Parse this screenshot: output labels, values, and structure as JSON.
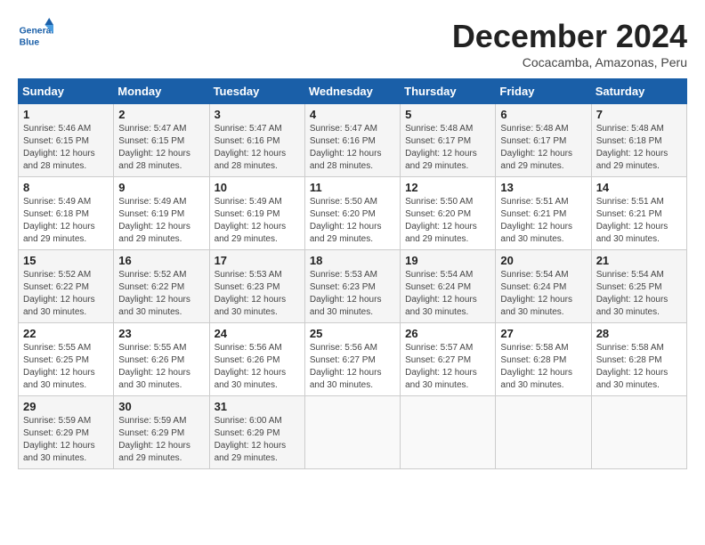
{
  "header": {
    "logo_text_general": "General",
    "logo_text_blue": "Blue",
    "month_title": "December 2024",
    "location": "Cocacamba, Amazonas, Peru"
  },
  "calendar": {
    "days_of_week": [
      "Sunday",
      "Monday",
      "Tuesday",
      "Wednesday",
      "Thursday",
      "Friday",
      "Saturday"
    ],
    "weeks": [
      [
        {
          "day": "",
          "info": ""
        },
        {
          "day": "",
          "info": ""
        },
        {
          "day": "",
          "info": ""
        },
        {
          "day": "",
          "info": ""
        },
        {
          "day": "",
          "info": ""
        },
        {
          "day": "",
          "info": ""
        },
        {
          "day": "",
          "info": ""
        }
      ]
    ],
    "cells": [
      {
        "day": "1",
        "sunrise": "5:46 AM",
        "sunset": "6:15 PM",
        "daylight": "12 hours and 28 minutes."
      },
      {
        "day": "2",
        "sunrise": "5:47 AM",
        "sunset": "6:15 PM",
        "daylight": "12 hours and 28 minutes."
      },
      {
        "day": "3",
        "sunrise": "5:47 AM",
        "sunset": "6:16 PM",
        "daylight": "12 hours and 28 minutes."
      },
      {
        "day": "4",
        "sunrise": "5:47 AM",
        "sunset": "6:16 PM",
        "daylight": "12 hours and 28 minutes."
      },
      {
        "day": "5",
        "sunrise": "5:48 AM",
        "sunset": "6:17 PM",
        "daylight": "12 hours and 29 minutes."
      },
      {
        "day": "6",
        "sunrise": "5:48 AM",
        "sunset": "6:17 PM",
        "daylight": "12 hours and 29 minutes."
      },
      {
        "day": "7",
        "sunrise": "5:48 AM",
        "sunset": "6:18 PM",
        "daylight": "12 hours and 29 minutes."
      },
      {
        "day": "8",
        "sunrise": "5:49 AM",
        "sunset": "6:18 PM",
        "daylight": "12 hours and 29 minutes."
      },
      {
        "day": "9",
        "sunrise": "5:49 AM",
        "sunset": "6:19 PM",
        "daylight": "12 hours and 29 minutes."
      },
      {
        "day": "10",
        "sunrise": "5:49 AM",
        "sunset": "6:19 PM",
        "daylight": "12 hours and 29 minutes."
      },
      {
        "day": "11",
        "sunrise": "5:50 AM",
        "sunset": "6:20 PM",
        "daylight": "12 hours and 29 minutes."
      },
      {
        "day": "12",
        "sunrise": "5:50 AM",
        "sunset": "6:20 PM",
        "daylight": "12 hours and 29 minutes."
      },
      {
        "day": "13",
        "sunrise": "5:51 AM",
        "sunset": "6:21 PM",
        "daylight": "12 hours and 30 minutes."
      },
      {
        "day": "14",
        "sunrise": "5:51 AM",
        "sunset": "6:21 PM",
        "daylight": "12 hours and 30 minutes."
      },
      {
        "day": "15",
        "sunrise": "5:52 AM",
        "sunset": "6:22 PM",
        "daylight": "12 hours and 30 minutes."
      },
      {
        "day": "16",
        "sunrise": "5:52 AM",
        "sunset": "6:22 PM",
        "daylight": "12 hours and 30 minutes."
      },
      {
        "day": "17",
        "sunrise": "5:53 AM",
        "sunset": "6:23 PM",
        "daylight": "12 hours and 30 minutes."
      },
      {
        "day": "18",
        "sunrise": "5:53 AM",
        "sunset": "6:23 PM",
        "daylight": "12 hours and 30 minutes."
      },
      {
        "day": "19",
        "sunrise": "5:54 AM",
        "sunset": "6:24 PM",
        "daylight": "12 hours and 30 minutes."
      },
      {
        "day": "20",
        "sunrise": "5:54 AM",
        "sunset": "6:24 PM",
        "daylight": "12 hours and 30 minutes."
      },
      {
        "day": "21",
        "sunrise": "5:54 AM",
        "sunset": "6:25 PM",
        "daylight": "12 hours and 30 minutes."
      },
      {
        "day": "22",
        "sunrise": "5:55 AM",
        "sunset": "6:25 PM",
        "daylight": "12 hours and 30 minutes."
      },
      {
        "day": "23",
        "sunrise": "5:55 AM",
        "sunset": "6:26 PM",
        "daylight": "12 hours and 30 minutes."
      },
      {
        "day": "24",
        "sunrise": "5:56 AM",
        "sunset": "6:26 PM",
        "daylight": "12 hours and 30 minutes."
      },
      {
        "day": "25",
        "sunrise": "5:56 AM",
        "sunset": "6:27 PM",
        "daylight": "12 hours and 30 minutes."
      },
      {
        "day": "26",
        "sunrise": "5:57 AM",
        "sunset": "6:27 PM",
        "daylight": "12 hours and 30 minutes."
      },
      {
        "day": "27",
        "sunrise": "5:58 AM",
        "sunset": "6:28 PM",
        "daylight": "12 hours and 30 minutes."
      },
      {
        "day": "28",
        "sunrise": "5:58 AM",
        "sunset": "6:28 PM",
        "daylight": "12 hours and 30 minutes."
      },
      {
        "day": "29",
        "sunrise": "5:59 AM",
        "sunset": "6:29 PM",
        "daylight": "12 hours and 30 minutes."
      },
      {
        "day": "30",
        "sunrise": "5:59 AM",
        "sunset": "6:29 PM",
        "daylight": "12 hours and 29 minutes."
      },
      {
        "day": "31",
        "sunrise": "6:00 AM",
        "sunset": "6:29 PM",
        "daylight": "12 hours and 29 minutes."
      }
    ]
  }
}
